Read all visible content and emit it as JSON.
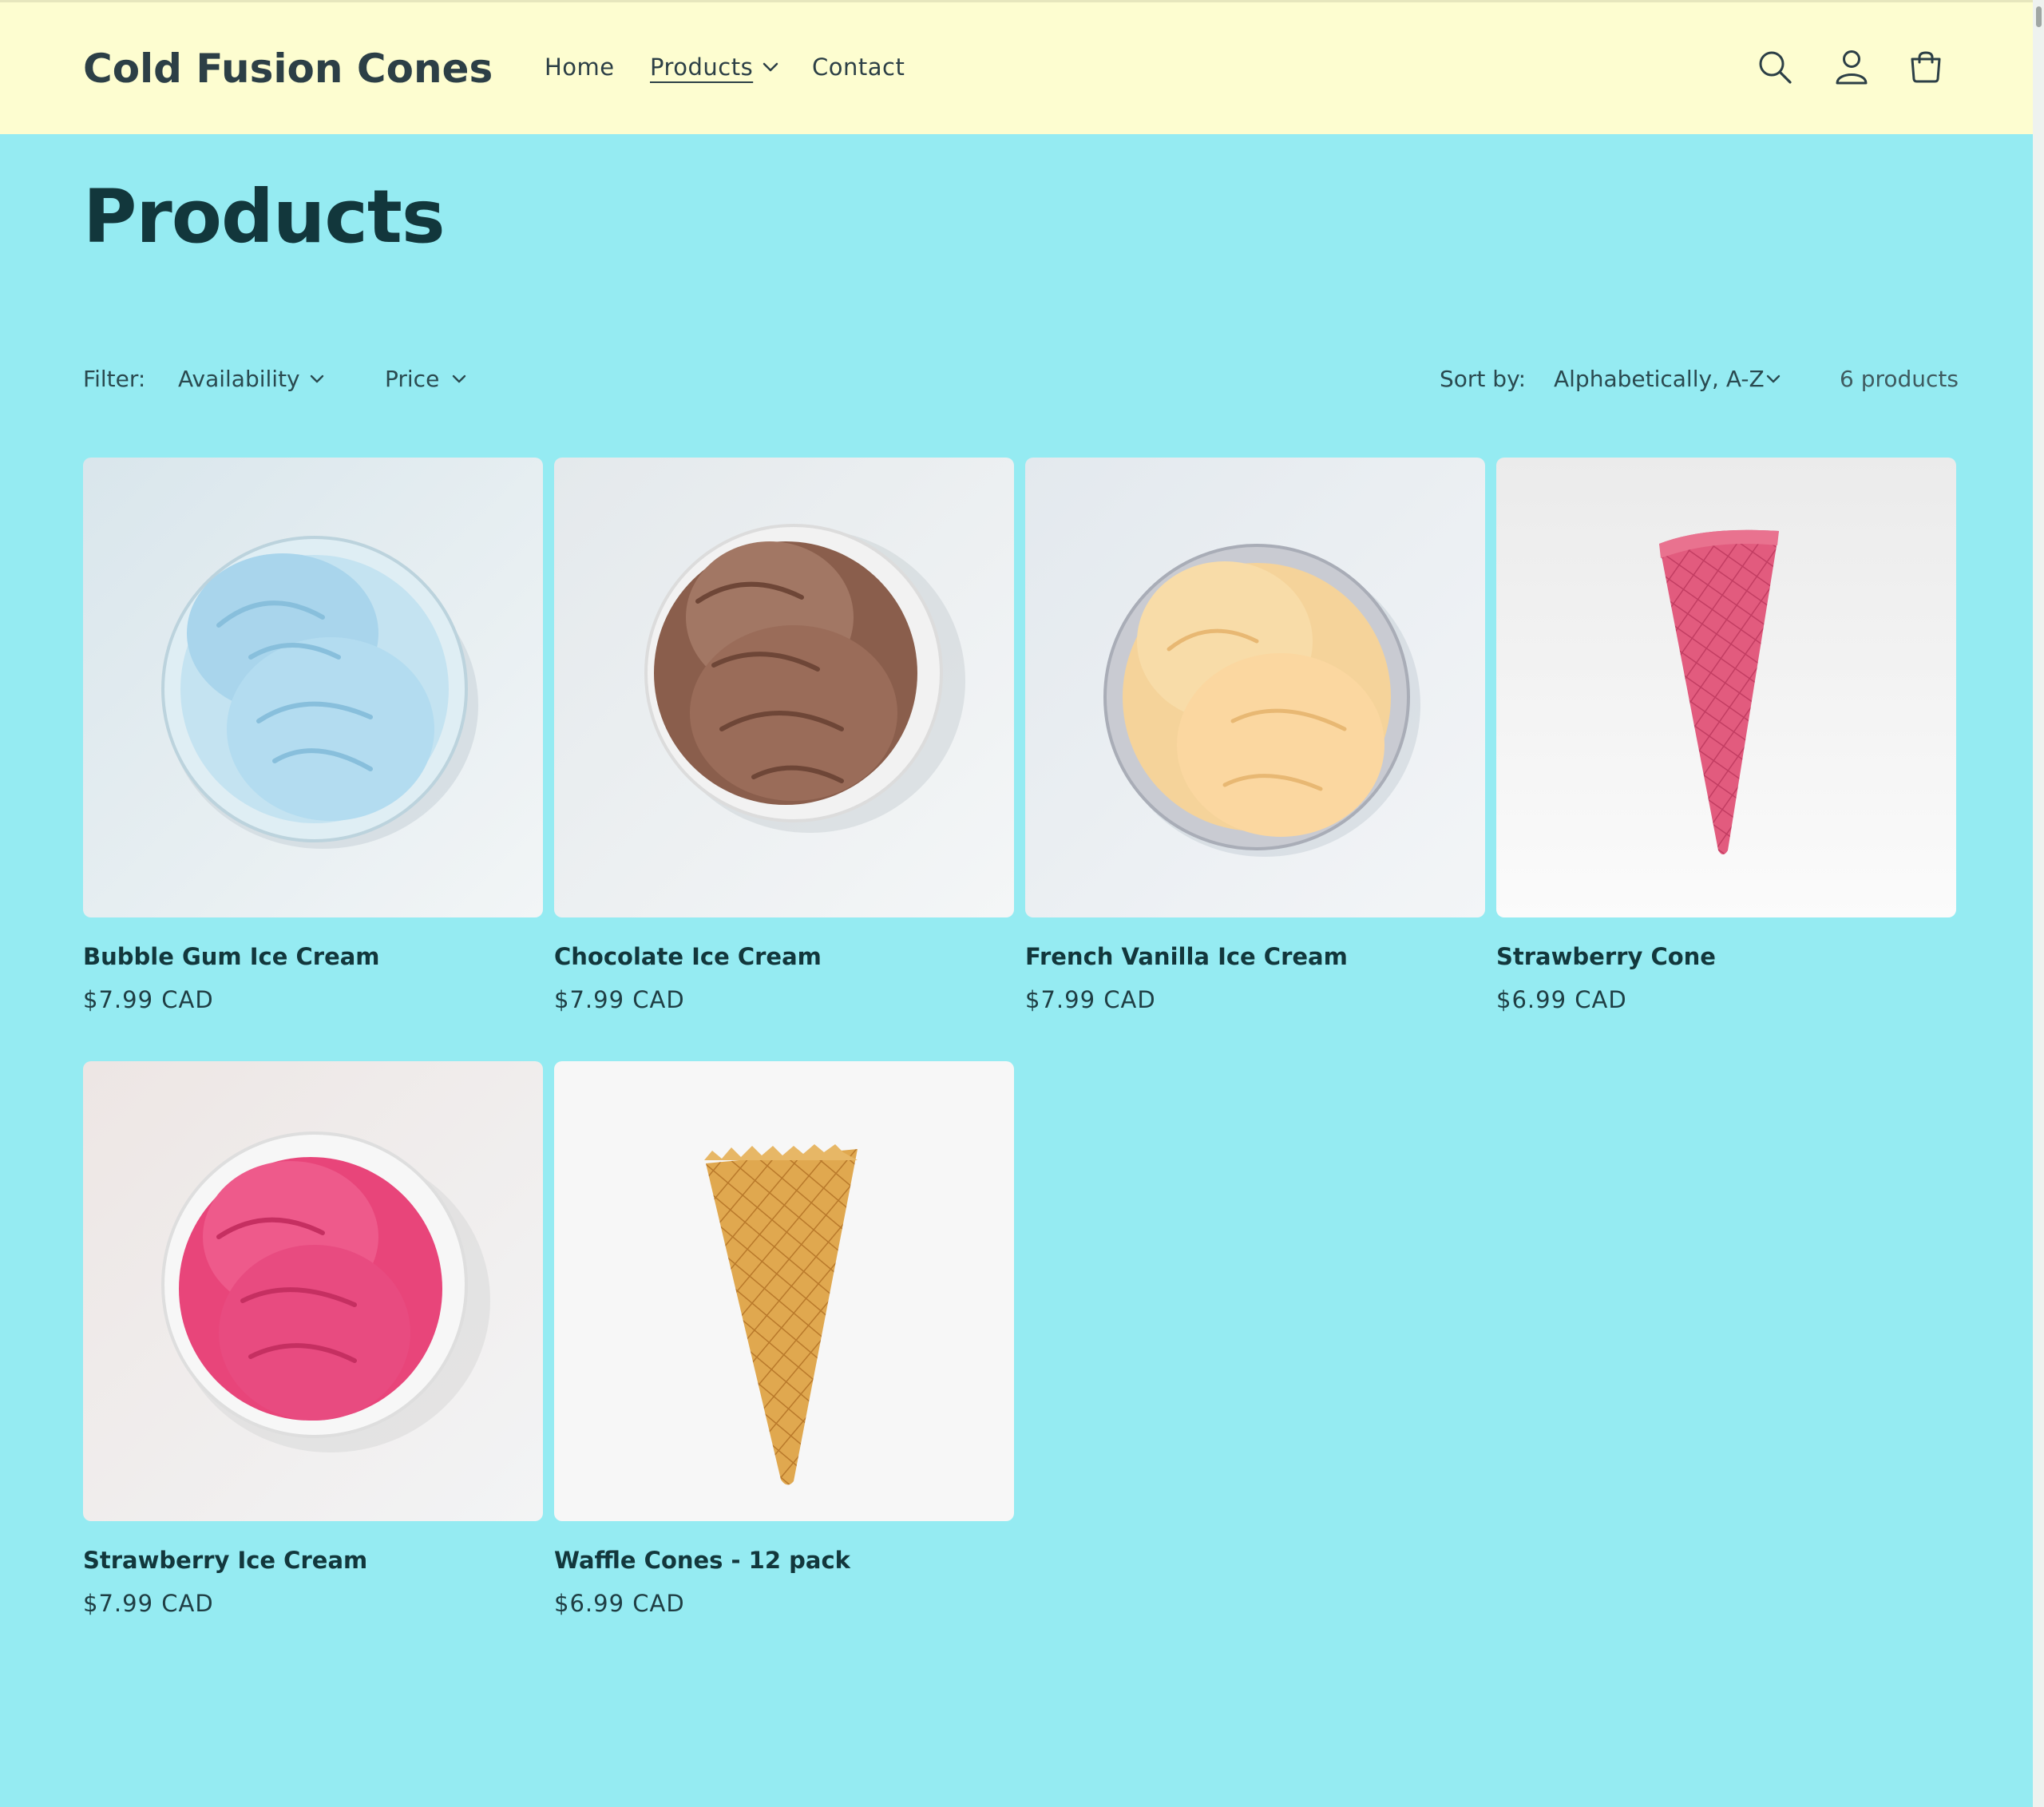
{
  "header": {
    "logo": "Cold Fusion Cones",
    "nav": [
      {
        "label": "Home"
      },
      {
        "label": "Products"
      },
      {
        "label": "Contact"
      }
    ]
  },
  "page": {
    "title": "Products"
  },
  "toolbar": {
    "filter_label": "Filter:",
    "filters": [
      {
        "label": "Availability"
      },
      {
        "label": "Price"
      }
    ],
    "sort_label": "Sort by:",
    "sort_value": "Alphabetically, A-Z",
    "count": "6 products"
  },
  "products": [
    {
      "title": "Bubble Gum Ice Cream",
      "price": "$7.99 CAD"
    },
    {
      "title": "Chocolate Ice Cream",
      "price": "$7.99 CAD"
    },
    {
      "title": "French Vanilla Ice Cream",
      "price": "$7.99 CAD"
    },
    {
      "title": "Strawberry Cone",
      "price": "$6.99 CAD"
    },
    {
      "title": "Strawberry Ice Cream",
      "price": "$7.99 CAD"
    },
    {
      "title": "Waffle Cones - 12 pack",
      "price": "$6.99 CAD"
    }
  ],
  "icons": {
    "header": [
      "search-icon",
      "account-icon",
      "cart-icon"
    ],
    "chevron": "chevron-down-icon"
  },
  "colors": {
    "header_bg": "#fdfdd0",
    "page_bg": "#95ebf2",
    "text": "#12373c"
  }
}
